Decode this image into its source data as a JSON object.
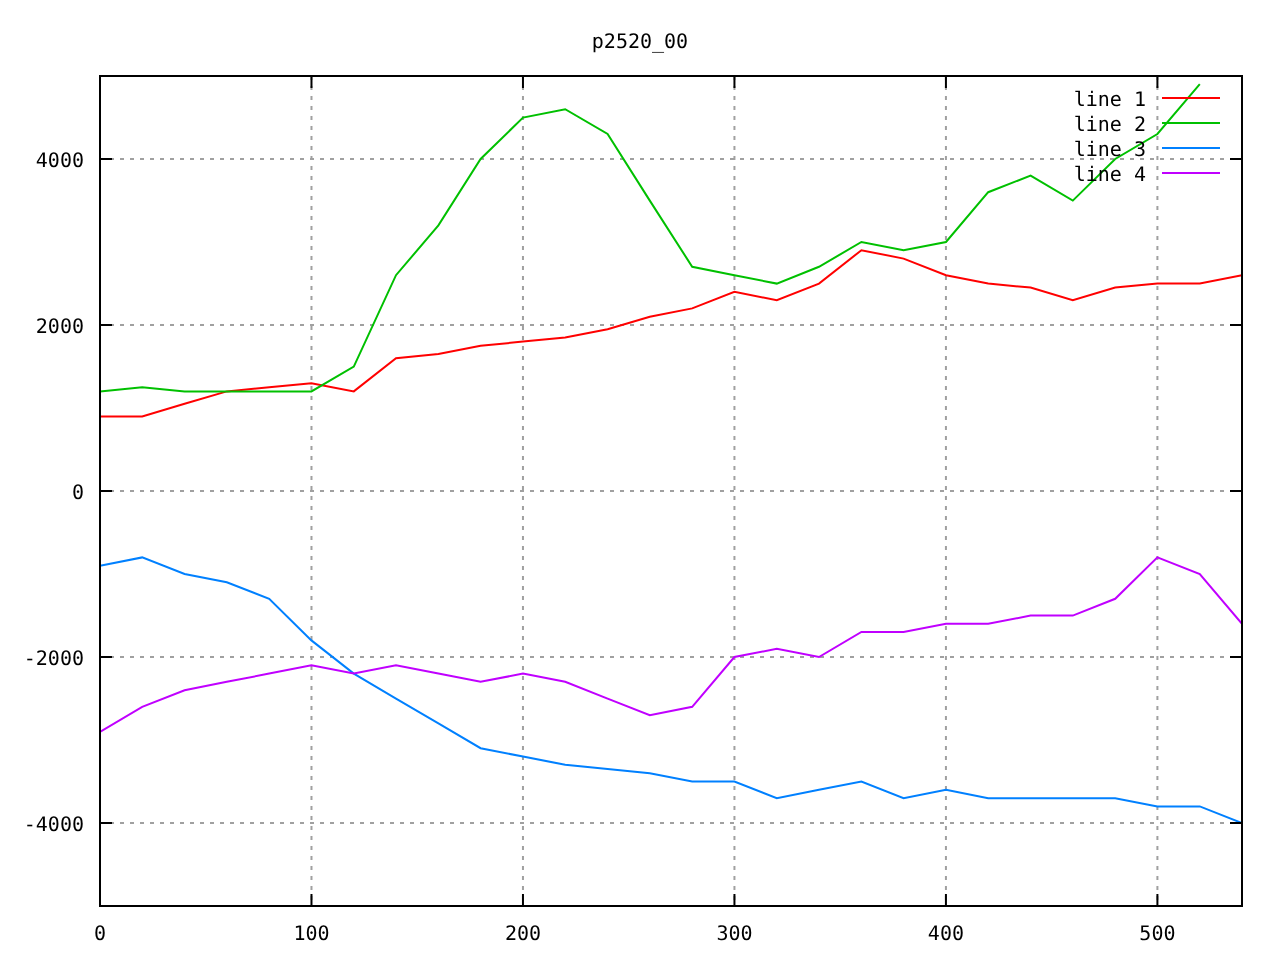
{
  "plot": {
    "chart_data": {
      "type": "line",
      "title": "p2520_00",
      "x": [
        0,
        20,
        40,
        60,
        80,
        100,
        120,
        140,
        160,
        180,
        200,
        220,
        240,
        260,
        280,
        300,
        320,
        340,
        360,
        380,
        400,
        420,
        440,
        460,
        480,
        500,
        520,
        540
      ],
      "xlim": [
        0,
        540
      ],
      "ylim": [
        -5000,
        5000
      ],
      "xticks": [
        0,
        100,
        200,
        300,
        400,
        500
      ],
      "yticks": [
        -4000,
        -2000,
        0,
        2000,
        4000
      ],
      "grid": true,
      "legend": true,
      "series": [
        {
          "name": "line 1",
          "color": "#ff0000",
          "values": [
            900,
            900,
            1050,
            1200,
            1250,
            1300,
            1200,
            1600,
            1650,
            1750,
            1800,
            1850,
            1950,
            2100,
            2200,
            2400,
            2300,
            2500,
            2900,
            2800,
            2600,
            2500,
            2450,
            2300,
            2450,
            2500,
            2500,
            2600
          ]
        },
        {
          "name": "line 2",
          "color": "#00c000",
          "values": [
            1200,
            1250,
            1200,
            1200,
            1200,
            1200,
            1500,
            2600,
            3200,
            4000,
            4500,
            4600,
            4300,
            3500,
            2700,
            2600,
            2500,
            2700,
            3000,
            2900,
            3000,
            3600,
            3800,
            3500,
            4000,
            4300,
            4900,
            null
          ]
        },
        {
          "name": "line 3",
          "color": "#0080ff",
          "values": [
            -900,
            -800,
            -1000,
            -1100,
            -1300,
            -1800,
            -2200,
            -2500,
            -2800,
            -3100,
            -3200,
            -3300,
            -3350,
            -3400,
            -3500,
            -3500,
            -3700,
            -3600,
            -3500,
            -3700,
            -3600,
            -3700,
            -3700,
            -3700,
            -3700,
            -3800,
            -3800,
            -4000
          ]
        },
        {
          "name": "line 4",
          "color": "#c000ff",
          "values": [
            -2900,
            -2600,
            -2400,
            -2300,
            -2200,
            -2100,
            -2200,
            -2100,
            -2200,
            -2300,
            -2200,
            -2300,
            -2500,
            -2700,
            -2600,
            -2000,
            -1900,
            -2000,
            -1700,
            -1700,
            -1600,
            -1600,
            -1500,
            -1500,
            -1300,
            -800,
            -1000,
            -1600
          ]
        }
      ]
    }
  }
}
